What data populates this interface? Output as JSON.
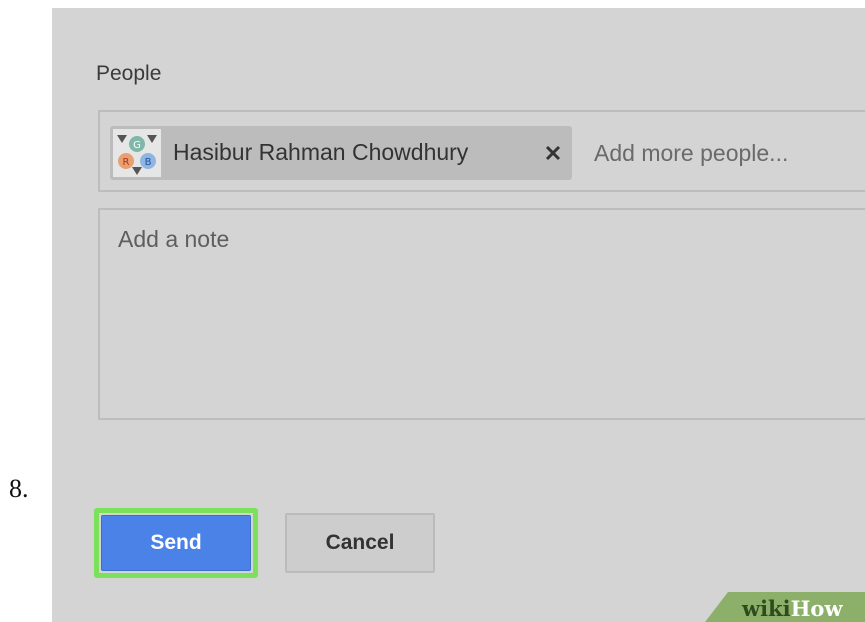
{
  "step_number": "8.",
  "people": {
    "label": "People",
    "recipient": {
      "name": "Hasibur Rahman Chowdhury",
      "avatar_icon": "gplus-avatar-icon",
      "remove_icon": "close-icon"
    },
    "add_placeholder": "Add more people..."
  },
  "note": {
    "placeholder": "Add a note"
  },
  "actions": {
    "send_label": "Send",
    "cancel_label": "Cancel"
  },
  "watermark": {
    "wiki": "wiki",
    "how": "How"
  },
  "colors": {
    "panel_background": "#d4d4d4",
    "send_button": "#4a82e8",
    "send_highlight": "#7be05a",
    "watermark_green": "#8cb06a"
  }
}
